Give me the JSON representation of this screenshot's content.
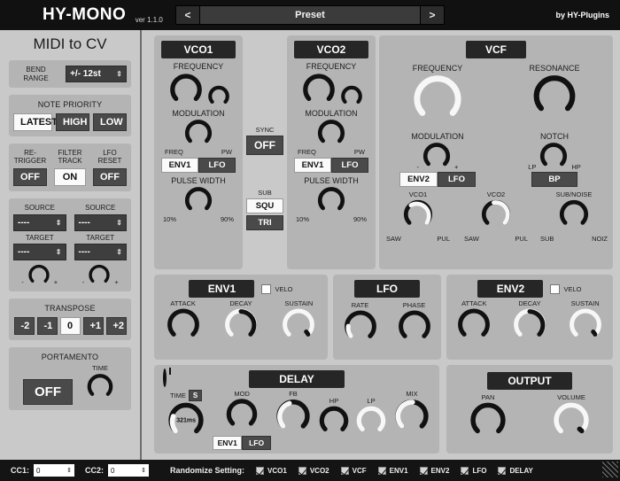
{
  "header": {
    "brand": "HY-MONO",
    "version": "ver 1.1.0",
    "prev_label": "<",
    "preset_name": "Preset",
    "next_label": ">",
    "credit": "by  HY-Plugins"
  },
  "sidebar": {
    "title": "MIDI to CV",
    "bend": {
      "label_line1": "BEND",
      "label_line2": "RANGE",
      "value": "+/- 12st"
    },
    "note_priority": {
      "title": "NOTE PRIORITY",
      "options": [
        "LATEST",
        "HIGH",
        "LOW"
      ],
      "selected": "LATEST"
    },
    "switches": [
      {
        "label_line1": "RE-",
        "label_line2": "TRIGGER",
        "value": "OFF",
        "active": false
      },
      {
        "label_line1": "FILTER",
        "label_line2": "TRACK",
        "value": "ON",
        "active": true
      },
      {
        "label_line1": "LFO",
        "label_line2": "RESET",
        "value": "OFF",
        "active": false
      }
    ],
    "matrix": [
      {
        "source_label": "SOURCE",
        "source_value": "----",
        "target_label": "TARGET",
        "target_value": "----",
        "minus": "-",
        "plus": "+"
      },
      {
        "source_label": "SOURCE",
        "source_value": "----",
        "target_label": "TARGET",
        "target_value": "----",
        "minus": "-",
        "plus": "+"
      }
    ],
    "transpose": {
      "title": "TRANSPOSE",
      "options": [
        "-2",
        "-1",
        "0",
        "+1",
        "+2"
      ],
      "selected": "0"
    },
    "portamento": {
      "title": "PORTAMENTO",
      "state": "OFF",
      "time_label": "TIME"
    }
  },
  "vco1": {
    "title": "VCO1",
    "frequency_label": "FREQUENCY",
    "modulation_label": "MODULATION",
    "mod_src_left": "FREQ",
    "mod_src_right": "PW",
    "mod_targets": [
      "ENV1",
      "LFO"
    ],
    "mod_selected": "ENV1",
    "pulse_width_label": "PULSE WIDTH",
    "pw_min": "10%",
    "pw_max": "90%"
  },
  "vco2": {
    "title": "VCO2",
    "frequency_label": "FREQUENCY",
    "modulation_label": "MODULATION",
    "mod_src_left": "FREQ",
    "mod_src_right": "PW",
    "mod_targets": [
      "ENV1",
      "LFO"
    ],
    "mod_selected": "ENV1",
    "pulse_width_label": "PULSE WIDTH",
    "pw_min": "10%",
    "pw_max": "90%"
  },
  "middle": {
    "sync_label": "SYNC",
    "sync_value": "OFF",
    "sub_label": "SUB",
    "sub_options": [
      "SQU",
      "TRI"
    ],
    "sub_selected": "SQU"
  },
  "vcf": {
    "title": "VCF",
    "frequency_label": "FREQUENCY",
    "resonance_label": "RESONANCE",
    "modulation_label": "MODULATION",
    "mod_minus": "-",
    "mod_plus": "+",
    "notch_label": "NOTCH",
    "notch_min": "LP",
    "notch_max": "HP",
    "mod_targets": [
      "ENV2",
      "LFO"
    ],
    "mod_selected": "ENV2",
    "filter_mode": "BP",
    "filter_mode_active": false,
    "mix": [
      {
        "label": "VCO1",
        "min": "SAW",
        "max": "PUL"
      },
      {
        "label": "VCO2",
        "min": "SAW",
        "max": "PUL"
      },
      {
        "label": "SUB/NOISE",
        "min": "SUB",
        "max": "NOIZ"
      }
    ]
  },
  "env1": {
    "title": "ENV1",
    "velo_label": "VELO",
    "velo_checked": false,
    "knobs": [
      {
        "label": "ATTACK"
      },
      {
        "label": "DECAY"
      },
      {
        "label": "SUSTAIN"
      }
    ]
  },
  "lfo": {
    "title": "LFO",
    "knobs": [
      {
        "label": "RATE"
      },
      {
        "label": "PHASE"
      }
    ]
  },
  "env2": {
    "title": "ENV2",
    "velo_label": "VELO",
    "velo_checked": false,
    "knobs": [
      {
        "label": "ATTACK"
      },
      {
        "label": "DECAY"
      },
      {
        "label": "SUSTAIN"
      }
    ]
  },
  "delay": {
    "title": "DELAY",
    "time_label": "TIME",
    "sync_badge": "S",
    "time_value": "321ms",
    "mod_label": "MOD",
    "mod_targets": [
      "ENV1",
      "LFO"
    ],
    "mod_selected": "ENV1",
    "knobs": [
      {
        "label": "FB"
      },
      {
        "label": "HP"
      },
      {
        "label": "LP"
      },
      {
        "label": "MIX"
      }
    ]
  },
  "output": {
    "title": "OUTPUT",
    "knobs": [
      {
        "label": "PAN"
      },
      {
        "label": "VOLUME"
      }
    ]
  },
  "footer": {
    "cc1_label": "CC1:",
    "cc1_value": "0",
    "cc2_label": "CC2:",
    "cc2_value": "0",
    "randomize_label": "Randomize Setting:",
    "randomize_items": [
      {
        "label": "VCO1",
        "checked": true
      },
      {
        "label": "VCO2",
        "checked": true
      },
      {
        "label": "VCF",
        "checked": true
      },
      {
        "label": "ENV1",
        "checked": true
      },
      {
        "label": "ENV2",
        "checked": true
      },
      {
        "label": "LFO",
        "checked": true
      },
      {
        "label": "DELAY",
        "checked": true
      }
    ]
  }
}
